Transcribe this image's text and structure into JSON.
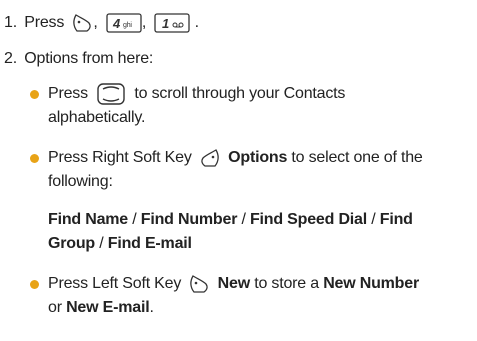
{
  "steps": [
    {
      "number": "1.",
      "text_press": "Press",
      "keys": [
        "left-soft-key-icon",
        "key-4-ghi",
        "key-1-voicemail"
      ],
      "key_labels": [
        "4",
        "ghi",
        "1"
      ],
      "sep": ",",
      "end": "."
    },
    {
      "number": "2.",
      "text": "Options from here:"
    }
  ],
  "bullets": [
    {
      "press": "Press",
      "icon": "navigation-key-icon",
      "text_line1": "to scroll through your Contacts",
      "text_line2": "alphabetically."
    },
    {
      "press": "Press Right Soft Key",
      "icon": "right-soft-key-icon",
      "bold": "Options",
      "text_line1": "to select one of the",
      "text_line2": "following:"
    },
    {
      "press": "Press Left Soft Key",
      "icon": "left-soft-key-icon",
      "bold": "New",
      "text_mid": "to store a",
      "bold2": "New Number",
      "line2_pre": "or",
      "bold3": "New E-mail",
      "line2_end": "."
    }
  ],
  "find_options": {
    "items": [
      "Find Name",
      "Find Number",
      "Find Speed Dial",
      "Find",
      "Group",
      "Find E-mail"
    ],
    "sep": "/"
  },
  "colors": {
    "bullet": "#e8a317"
  }
}
